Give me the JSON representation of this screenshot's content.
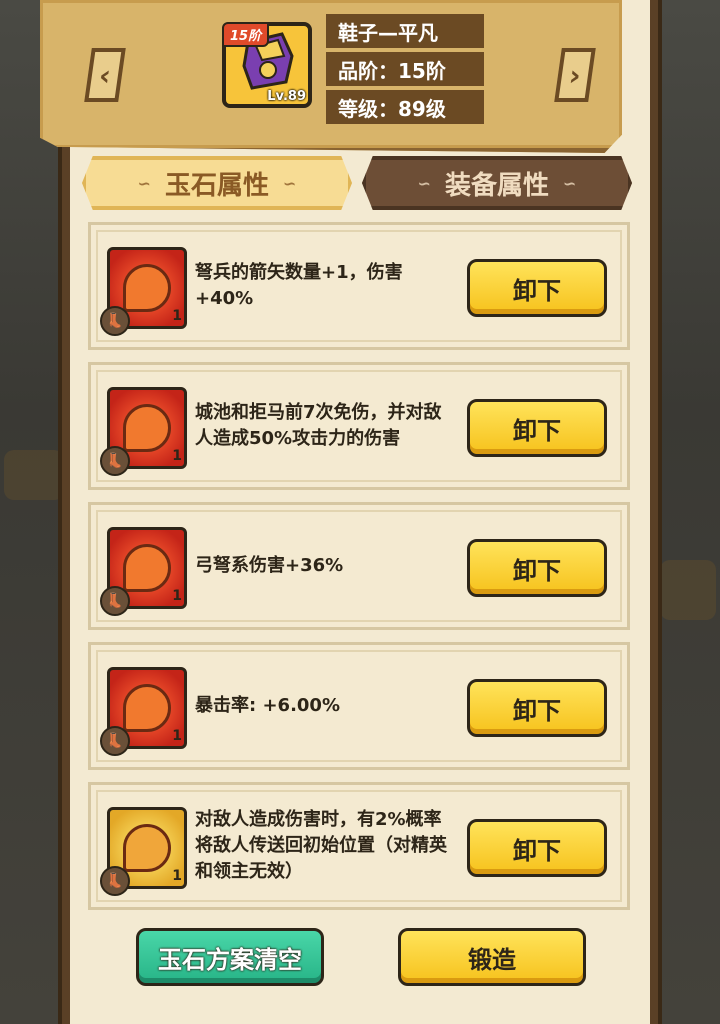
{
  "item": {
    "name": "鞋子—平凡",
    "tier_badge": "15阶",
    "level_badge": "Lv.89",
    "quality": "品阶：15阶",
    "level": "等级：89级",
    "icon": "golden-winged-boot-icon"
  },
  "nav": {
    "prev_icon": "chevron-left-icon",
    "next_icon": "chevron-right-icon"
  },
  "tabs": [
    {
      "label": "玉石属性",
      "active": true
    },
    {
      "label": "装备属性",
      "active": false
    }
  ],
  "gems": [
    {
      "color": "red",
      "count": "1",
      "description": "弩兵的箭矢数量+1，伤害+40%",
      "button": "卸下"
    },
    {
      "color": "red",
      "count": "1",
      "description": "城池和拒马前7次免伤，并对敌人造成50%攻击力的伤害",
      "button": "卸下"
    },
    {
      "color": "red",
      "count": "1",
      "description": "弓弩系伤害+36%",
      "button": "卸下"
    },
    {
      "color": "red",
      "count": "1",
      "description": "暴击率: +6.00%",
      "button": "卸下"
    },
    {
      "color": "gold",
      "count": "1",
      "description": "对敌人造成伤害时，有2%概率将敌人传送回初始位置（对精英和领主无效）",
      "button": "卸下"
    }
  ],
  "actions": {
    "clear_label": "玉石方案清空",
    "forge_label": "锻造"
  },
  "colors": {
    "accent_yellow": "#f6c21c",
    "accent_green": "#27b487",
    "gem_red": "#c42418",
    "gem_gold": "#e3a827",
    "parchment": "#f3ead2"
  }
}
